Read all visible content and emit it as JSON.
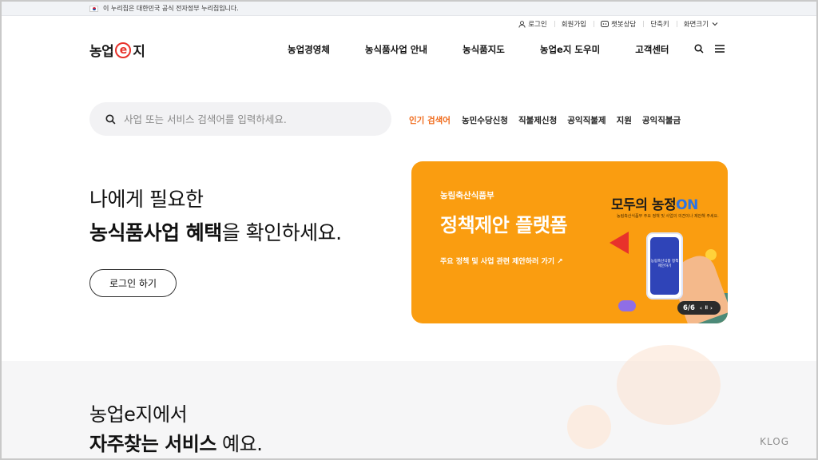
{
  "gov_banner": {
    "text": "이 누리집은 대한민국 공식 전자정부 누리집입니다."
  },
  "util_nav": {
    "login": "로그인",
    "signup": "회원가입",
    "chatbot": "챗봇상담",
    "shortcut": "단축키",
    "screen_size": "화면크기"
  },
  "logo": {
    "part1": "농업",
    "part2": "e",
    "part3": "지"
  },
  "gnb": [
    "농업경영체",
    "농식품사업 안내",
    "농식품지도",
    "농업e지 도우미",
    "고객센터"
  ],
  "search": {
    "placeholder": "사업 또는 서비스 검색어를 입력하세요."
  },
  "popular": {
    "label": "인기 검색어",
    "keywords": [
      "농민수당신청",
      "직불제신청",
      "공익직불제",
      "지원",
      "공익직불금"
    ]
  },
  "hero": {
    "line1": "나에게 필요한",
    "line2_bold": "농식품사업 혜택",
    "line2_rest": "을 확인하세요.",
    "login_button": "로그인 하기"
  },
  "banner": {
    "org": "농림축산식품부",
    "title": "정책제안 플랫폼",
    "link": "주요 정책 및 사업 관련 제안하러 가기 ↗",
    "ad_title_main": "모두의 농정",
    "ad_title_on": "ON",
    "ad_sub": "농림축산식품부 주요 정책 및 사업의 의견이나 제안해 주세요.",
    "phone_text": "농림축산식품 정책 제안하기",
    "counter": "6/6",
    "colors": {
      "bg": "#fa9d10",
      "accent": "#2a74e6"
    }
  },
  "lower": {
    "line1": "농업e지에서",
    "line2_bold": "자주찾는 서비스",
    "line2_rest": " 예요."
  },
  "watermark": "KLOG",
  "colors": {
    "brand_red": "#e8322b",
    "popular_orange": "#f06a1a"
  }
}
